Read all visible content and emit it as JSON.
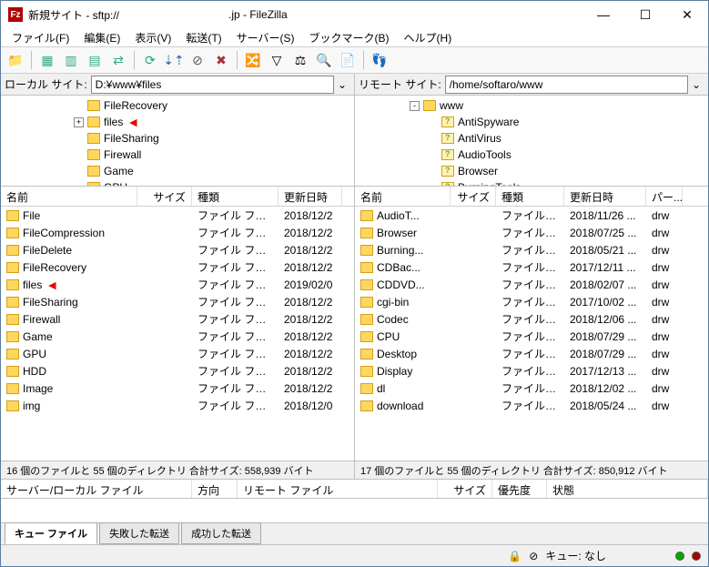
{
  "title": {
    "prefix": "新規サイト - sftp://",
    "host": ".jp - FileZilla"
  },
  "menu": {
    "file": "ファイル(F)",
    "edit": "編集(E)",
    "view": "表示(V)",
    "transfer": "転送(T)",
    "server": "サーバー(S)",
    "bookmarks": "ブックマーク(B)",
    "help": "ヘルプ(H)"
  },
  "local": {
    "label": "ローカル サイト:",
    "path": "D:¥www¥files",
    "tree": [
      {
        "indent": 80,
        "exp": "",
        "name": "FileRecovery",
        "q": false
      },
      {
        "indent": 80,
        "exp": "+",
        "name": "files",
        "q": false,
        "arrow": true
      },
      {
        "indent": 80,
        "exp": "",
        "name": "FileSharing",
        "q": false
      },
      {
        "indent": 80,
        "exp": "",
        "name": "Firewall",
        "q": false
      },
      {
        "indent": 80,
        "exp": "",
        "name": "Game",
        "q": false
      },
      {
        "indent": 80,
        "exp": "",
        "name": "GPU",
        "q": false
      }
    ],
    "cols": {
      "name": "名前",
      "size": "サイズ",
      "type": "種類",
      "date": "更新日時"
    },
    "rows": [
      {
        "name": "File",
        "type": "ファイル フォルダー",
        "date": "2018/12/2"
      },
      {
        "name": "FileCompression",
        "type": "ファイル フォルダー",
        "date": "2018/12/2"
      },
      {
        "name": "FileDelete",
        "type": "ファイル フォルダー",
        "date": "2018/12/2"
      },
      {
        "name": "FileRecovery",
        "type": "ファイル フォルダー",
        "date": "2018/12/2"
      },
      {
        "name": "files",
        "type": "ファイル フォルダー",
        "date": "2019/02/0",
        "arrow": true
      },
      {
        "name": "FileSharing",
        "type": "ファイル フォルダー",
        "date": "2018/12/2"
      },
      {
        "name": "Firewall",
        "type": "ファイル フォルダー",
        "date": "2018/12/2"
      },
      {
        "name": "Game",
        "type": "ファイル フォルダー",
        "date": "2018/12/2"
      },
      {
        "name": "GPU",
        "type": "ファイル フォルダー",
        "date": "2018/12/2"
      },
      {
        "name": "HDD",
        "type": "ファイル フォルダー",
        "date": "2018/12/2"
      },
      {
        "name": "Image",
        "type": "ファイル フォルダー",
        "date": "2018/12/2"
      },
      {
        "name": "img",
        "type": "ファイル フォルダー",
        "date": "2018/12/0"
      }
    ],
    "status": "16 個のファイルと 55 個のディレクトリ 合計サイズ: 558,939 バイト"
  },
  "remote": {
    "label": "リモート サイト:",
    "path": "/home/softaro/www",
    "tree": [
      {
        "indent": 60,
        "exp": "-",
        "name": "www",
        "q": false
      },
      {
        "indent": 80,
        "exp": "",
        "name": "AntiSpyware",
        "q": true
      },
      {
        "indent": 80,
        "exp": "",
        "name": "AntiVirus",
        "q": true
      },
      {
        "indent": 80,
        "exp": "",
        "name": "AudioTools",
        "q": true
      },
      {
        "indent": 80,
        "exp": "",
        "name": "Browser",
        "q": true
      },
      {
        "indent": 80,
        "exp": "",
        "name": "BurningTools",
        "q": true
      }
    ],
    "cols": {
      "name": "名前",
      "size": "サイズ",
      "type": "種類",
      "date": "更新日時",
      "perm": "パー..."
    },
    "rows": [
      {
        "name": "AudioT...",
        "type": "ファイル フォ...",
        "date": "2018/11/26 ...",
        "perm": "drw"
      },
      {
        "name": "Browser",
        "type": "ファイル フォ...",
        "date": "2018/07/25 ...",
        "perm": "drw"
      },
      {
        "name": "Burning...",
        "type": "ファイル フォ...",
        "date": "2018/05/21 ...",
        "perm": "drw"
      },
      {
        "name": "CDBac...",
        "type": "ファイル フォ...",
        "date": "2017/12/11 ...",
        "perm": "drw"
      },
      {
        "name": "CDDVD...",
        "type": "ファイル フォ...",
        "date": "2018/02/07 ...",
        "perm": "drw"
      },
      {
        "name": "cgi-bin",
        "type": "ファイル フォ...",
        "date": "2017/10/02 ...",
        "perm": "drw"
      },
      {
        "name": "Codec",
        "type": "ファイル フォ...",
        "date": "2018/12/06 ...",
        "perm": "drw"
      },
      {
        "name": "CPU",
        "type": "ファイル フォ...",
        "date": "2018/07/29 ...",
        "perm": "drw"
      },
      {
        "name": "Desktop",
        "type": "ファイル フォ...",
        "date": "2018/07/29 ...",
        "perm": "drw"
      },
      {
        "name": "Display",
        "type": "ファイル フォ...",
        "date": "2017/12/13 ...",
        "perm": "drw"
      },
      {
        "name": "dl",
        "type": "ファイル フォ...",
        "date": "2018/12/02 ...",
        "perm": "drw"
      },
      {
        "name": "download",
        "type": "ファイル フォ...",
        "date": "2018/05/24 ...",
        "perm": "drw"
      }
    ],
    "status": "17 個のファイルと 55 個のディレクトリ 合計サイズ: 850,912 バイト"
  },
  "queue": {
    "cols": {
      "file": "サーバー/ローカル ファイル",
      "dir": "方向",
      "remote": "リモート ファイル",
      "size": "サイズ",
      "prio": "優先度",
      "state": "状態"
    },
    "tabs": {
      "queued": "キュー ファイル",
      "failed": "失敗した転送",
      "success": "成功した転送"
    }
  },
  "statusbar": {
    "queue": "キュー: なし"
  }
}
